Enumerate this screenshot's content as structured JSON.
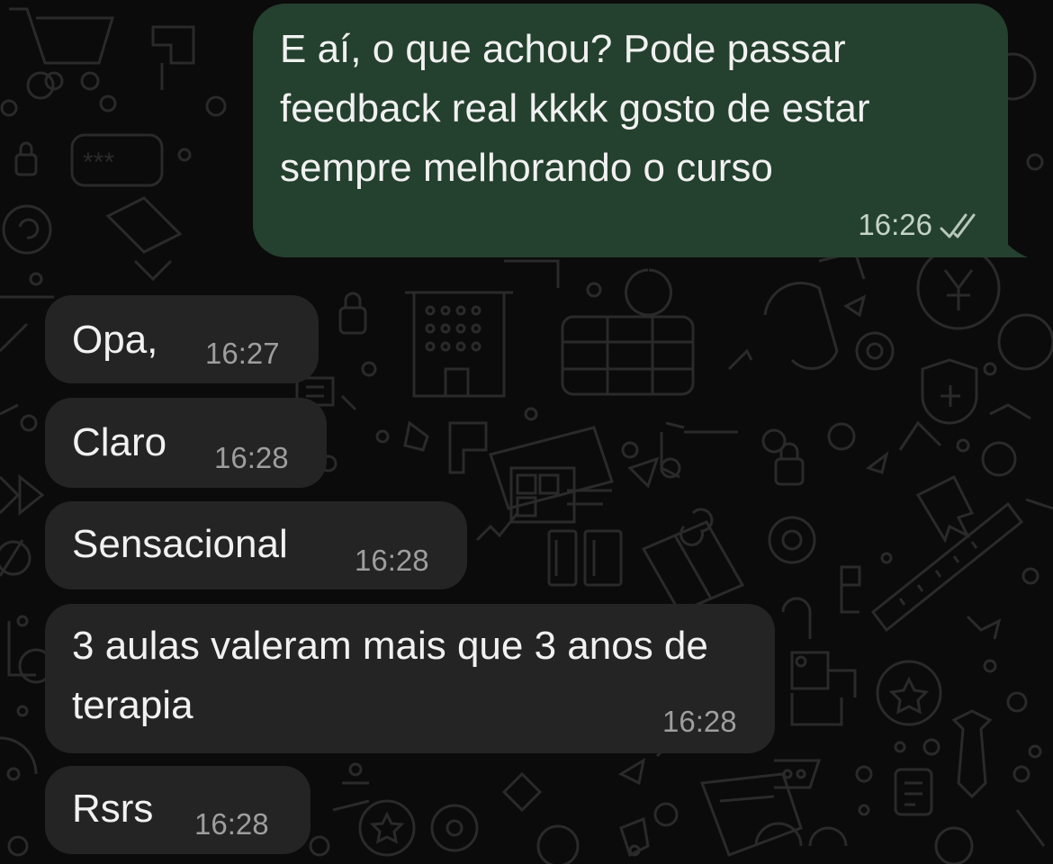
{
  "messages": [
    {
      "direction": "outgoing",
      "text": "E aí, o que achou? Pode passar feedback real kkkk gosto de estar sempre melhorando o curso",
      "time": "16:26",
      "status": "read-double-check-icon"
    },
    {
      "direction": "incoming",
      "text": "Opa,",
      "time": "16:27"
    },
    {
      "direction": "incoming",
      "text": "Claro",
      "time": "16:28"
    },
    {
      "direction": "incoming",
      "text": "Sensacional",
      "time": "16:28"
    },
    {
      "direction": "incoming",
      "text": "3 aulas valeram mais que 3 anos de terapia",
      "time": "16:28"
    },
    {
      "direction": "incoming",
      "text": "Rsrs",
      "time": "16:28"
    }
  ],
  "colors": {
    "background": "#0b0b0b",
    "outgoing_bubble": "#24402e",
    "incoming_bubble": "#242424",
    "text": "#f1f1f1",
    "timestamp": "#9e9e9e"
  }
}
